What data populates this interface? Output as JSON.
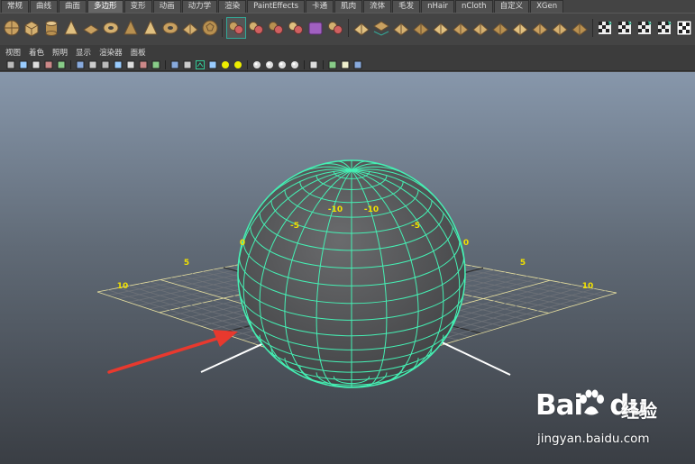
{
  "tabs": [
    {
      "label": "常规",
      "active": false
    },
    {
      "label": "曲线",
      "active": false
    },
    {
      "label": "曲面",
      "active": false
    },
    {
      "label": "多边形",
      "active": true
    },
    {
      "label": "变形",
      "active": false
    },
    {
      "label": "动画",
      "active": false
    },
    {
      "label": "动力学",
      "active": false
    },
    {
      "label": "渲染",
      "active": false
    },
    {
      "label": "PaintEffects",
      "active": false
    },
    {
      "label": "卡通",
      "active": false
    },
    {
      "label": "肌肉",
      "active": false
    },
    {
      "label": "流体",
      "active": false
    },
    {
      "label": "毛发",
      "active": false
    },
    {
      "label": "nHair",
      "active": false
    },
    {
      "label": "nCloth",
      "active": false
    },
    {
      "label": "自定义",
      "active": false
    },
    {
      "label": "XGen",
      "active": false
    }
  ],
  "shelf_icons": [
    "poly-sphere-icon",
    "poly-cube-icon",
    "poly-cylinder-icon",
    "poly-cone-icon",
    "poly-plane-icon",
    "poly-torus-icon",
    "poly-prism-icon",
    "poly-pyramid-icon",
    "poly-pipe-icon",
    "poly-helix-icon",
    "poly-soccer-ball-icon",
    "separator",
    "combine-icon",
    "separate-icon",
    "extract-icon",
    "smooth-icon",
    "boolean-icon",
    "average-vertices-icon",
    "separator",
    "extrude-icon",
    "bridge-icon",
    "append-polygon-icon",
    "split-polygon-icon",
    "insert-edge-loop-icon",
    "offset-edge-loop-icon",
    "merge-vertices-icon",
    "merge-edge-icon",
    "collapse-icon",
    "delete-edge-icon",
    "chamfer-vertex-icon",
    "bevel-icon",
    "separator",
    "planar-mapping-icon",
    "cylindrical-mapping-icon",
    "spherical-mapping-icon",
    "automatic-mapping-icon",
    "uv-editor-icon"
  ],
  "menubar": [
    "视图",
    "着色",
    "照明",
    "显示",
    "渲染器",
    "面板"
  ],
  "panel_tools": [
    "camera-attributes-icon",
    "bookmark-icon",
    "image-plane-icon",
    "2d-pan-icon",
    "grease-pencil-icon",
    "separator",
    "grid-toggle-icon",
    "film-gate-icon",
    "resolution-gate-icon",
    "gate-mask-icon",
    "field-chart-icon",
    "safe-action-icon",
    "safe-title-icon",
    "separator",
    "wireframe-icon",
    "smooth-shade-icon",
    "wireframe-on-shaded-icon",
    "textured-icon",
    "use-all-lights-icon",
    "shadows-icon",
    "separator",
    "screen-space-ao-icon",
    "motion-blur-icon",
    "multisample-aa-icon",
    "depth-of-field-icon",
    "separator",
    "isolate-select-icon",
    "separator",
    "xray-icon",
    "xray-joints-icon",
    "xray-components-icon"
  ],
  "viewport": {
    "axis_labels": [
      "10",
      "5",
      "0",
      "-5",
      "-10",
      "-10",
      "-5",
      "0",
      "5",
      "10"
    ]
  },
  "colors": {
    "grid": "#d7d7d7",
    "grid_axis": "#e8e0a0",
    "grid_label": "#f0e000",
    "sphere_wire": "#45f0b4",
    "arrow": "#e8392e"
  },
  "watermark": {
    "brand": "Bai",
    "brand_tail": "du",
    "sub": "经验",
    "url": "jingyan.baidu.com"
  }
}
